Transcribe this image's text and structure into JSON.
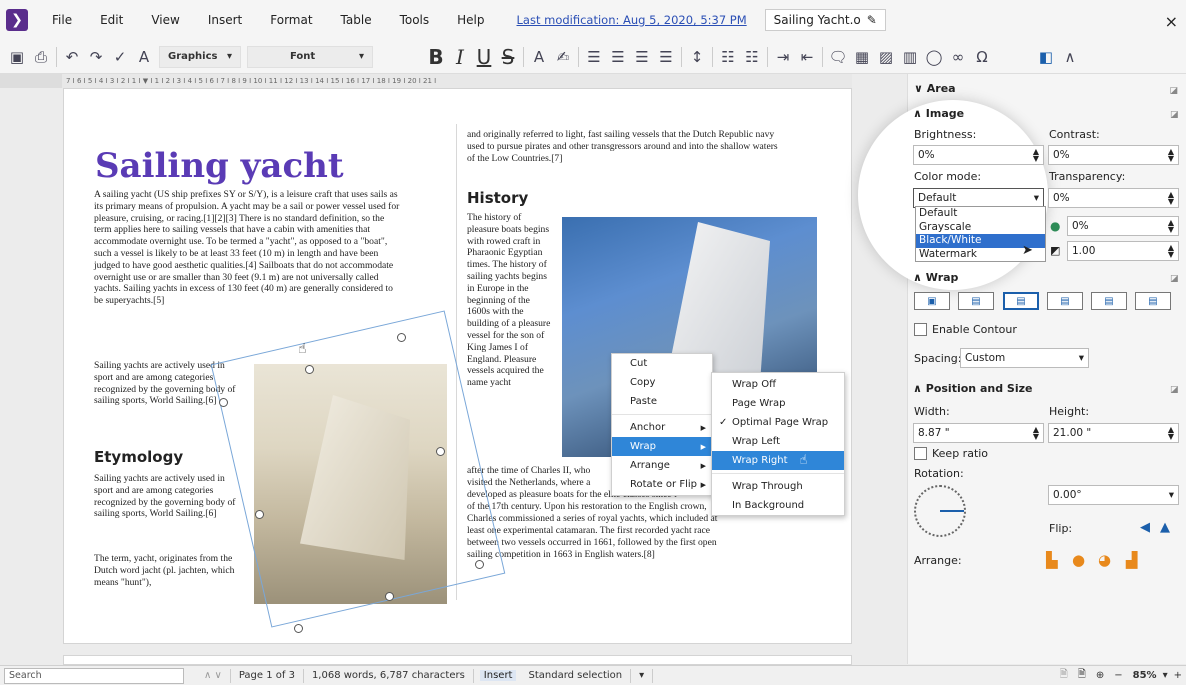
{
  "menubar": {
    "items": [
      "File",
      "Edit",
      "View",
      "Insert",
      "Format",
      "Table",
      "Tools",
      "Help"
    ],
    "last_modification": "Last modification: Aug 5, 2020, 5:37 PM",
    "doc_title": "Sailing Yacht.o",
    "close": "×"
  },
  "toolbar": {
    "style_select": "Graphics",
    "font_select": "Font",
    "bold": "B",
    "italic": "I",
    "underline": "U",
    "strike": "S"
  },
  "ruler": {
    "ticks": "7 I 6 I 5 I 4 I 3 I 2 I 1 I ▼ I 1 I 2 I 3 I 4 I 5 I 6 I 7 I 8 I 9 I 10 I 11 I 12 I 13 I 14 I 15 I 16 I 17 I 18 I 19 I 20 I 21 I"
  },
  "document": {
    "title": "Sailing yacht",
    "intro_p1": "A sailing yacht (US ship prefixes SY or S/Y), is a leisure craft that uses sails as its primary means of propulsion. A yacht may be a sail or power vessel used for pleasure, cruising, or racing.[1][2][3] There is no standard definition, so the term applies here to sailing vessels that have a cabin with amenities that accommodate overnight use. To be termed a \"yacht\", as opposed to a \"boat\", such a vessel is likely to be at least 33 feet (10 m) in length and have been judged to have good aesthetic qualities.[4] Sailboats that do not accommodate overnight use or are smaller than 30 feet (9.1 m) are not universally called yachts. Sailing yachts in excess of 130 feet (40 m) are generally considered to be superyachts.[5]",
    "intro_p2": "Sailing yachts are actively used in sport and are among categories recognized by the governing body of sailing sports, World Sailing.[6]",
    "etymology_heading": "Etymology",
    "etym_p1": "Sailing yachts are actively used in sport and are among categories recognized by the governing body of sailing sports, World Sailing.[6]",
    "etym_p2": "The term, yacht, originates from the Dutch word jacht (pl. jachten, which means \"hunt\"),",
    "right_top": "and originally referred to light, fast sailing vessels that the Dutch Republic navy used to pursue pirates and other transgressors around and into the shallow waters of the Low Countries.[7]",
    "history_heading": "History",
    "history_narrow": "The history of pleasure boats begins with rowed craft in Pharaonic Egyptian times. The history of sailing yachts begins in Europe in the beginning of the 1600s with the building of a pleasure vessel for the son of King James I of England. Pleasure vessels acquired the name yacht",
    "history_wide_1": "after the time of Charles II, who",
    "history_wide_2": "visited the Netherlands, where a",
    "history_wide_3": "developed as pleasure boats for the elite classes since t",
    "history_wide_4": "of the 17th century. Upon his restoration to the English crown,",
    "history_wide_5": "Charles commissioned a series of royal yachts, which included at",
    "history_wide_6": "least one experimental catamaran. The first recorded yacht race",
    "history_wide_7": "between two vessels occurred in 1661, followed by the first open",
    "history_wide_8": "sailing competition in 1663 in English waters.[8]"
  },
  "context_menu": {
    "items": [
      "Cut",
      "Copy",
      "Paste",
      "Anchor",
      "Wrap",
      "Arrange",
      "Rotate or Flip"
    ],
    "highlighted": "Wrap"
  },
  "wrap_submenu": {
    "items": [
      "Wrap Off",
      "Page Wrap",
      "Optimal Page Wrap",
      "Wrap Left",
      "Wrap Right",
      "Wrap Through",
      "In Background"
    ],
    "checked": "Optimal Page Wrap",
    "highlighted": "Wrap Right"
  },
  "sidebar": {
    "area_heading": "Area",
    "image_heading": "Image",
    "brightness_label": "Brightness:",
    "brightness_value": "0%",
    "contrast_label": "Contrast:",
    "contrast_value": "0%",
    "color_mode_label": "Color mode:",
    "color_mode_value": "Default",
    "transparency_label": "Transparency:",
    "transparency_value": "0%",
    "color_mode_options": [
      "Default",
      "Grayscale",
      "Black/White",
      "Watermark"
    ],
    "color_mode_highlight": "Black/White",
    "gamma_value": "0%",
    "gamma2_value": "1.00",
    "wrap_heading": "Wrap",
    "enable_contour": "Enable Contour",
    "spacing_label": "Spacing:",
    "spacing_value": "Custom",
    "pos_heading": "Position and Size",
    "width_label": "Width:",
    "width_value": "8.87 \"",
    "height_label": "Height:",
    "height_value": "21.00 \"",
    "keep_ratio": "Keep ratio",
    "rotation_label": "Rotation:",
    "rotation_value": "0.00°",
    "flip_label": "Flip:",
    "arrange_label": "Arrange:"
  },
  "statusbar": {
    "search_placeholder": "Search",
    "page": "Page 1 of 3",
    "words": "1,068 words, 6,787 characters",
    "insert": "Insert",
    "selection": "Standard selection",
    "zoom": "85%"
  }
}
